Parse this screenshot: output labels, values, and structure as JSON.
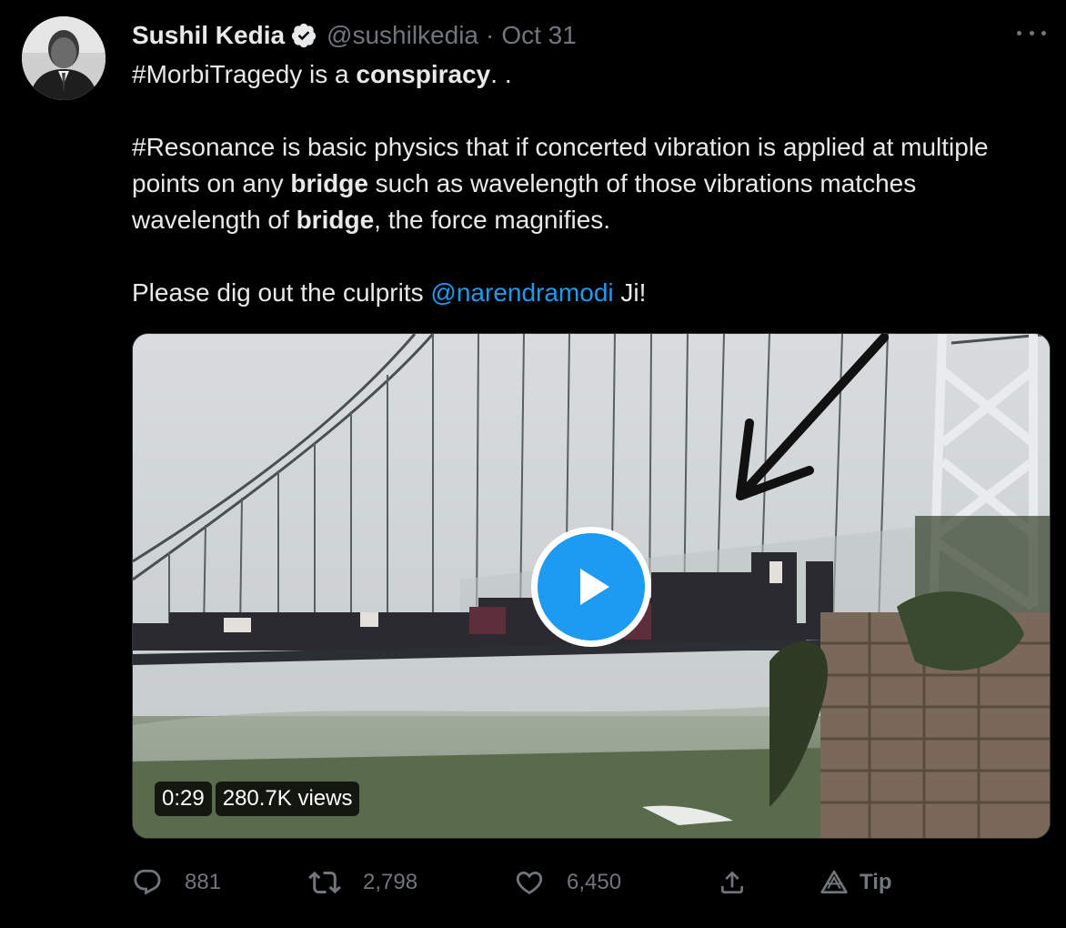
{
  "author": {
    "display_name": "Sushil Kedia",
    "handle": "@sushilkedia",
    "separator": "·",
    "date": "Oct 31",
    "verified": true
  },
  "tweet_text": {
    "line1_pre": "#MorbiTragedy is a ",
    "line1_bold": "conspiracy",
    "line1_post": ". .",
    "para2_a": "#Resonance is  basic physics that if concerted vibration is applied at multiple points on any ",
    "para2_bold1": "bridge",
    "para2_b": " such as wavelength of those vibrations matches wavelength of ",
    "para2_bold2": "bridge",
    "para2_c": ", the force magnifies.",
    "para3_pre": "Please dig out the culprits ",
    "para3_mention": "@narendramodi",
    "para3_post": "  Ji!"
  },
  "video": {
    "duration": "0:29",
    "views": "280.7K views"
  },
  "actions": {
    "reply_count": "881",
    "retweet_count": "2,798",
    "like_count": "6,450",
    "tip_label": "Tip"
  },
  "colors": {
    "background": "#000000",
    "text": "#e7e9ea",
    "muted": "#71767b",
    "accent": "#1d9bf0"
  },
  "icons": [
    "verified-icon",
    "more-icon",
    "play-icon",
    "reply-icon",
    "retweet-icon",
    "like-icon",
    "share-icon",
    "tip-icon"
  ]
}
